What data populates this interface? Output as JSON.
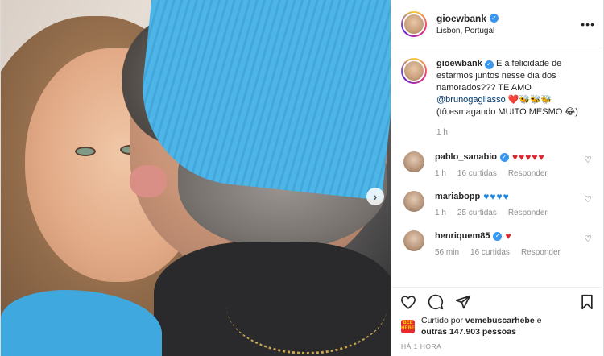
{
  "post": {
    "username": "gioewbank",
    "location": "Lisbon, Portugal",
    "caption_prefix": "E a felicidade de estarmos juntos nesse dia dos namorados??? TE AMO",
    "caption_mention": "@brunogagliasso",
    "caption_emojis": "❤️🐝🐝🐝",
    "caption_suffix": "(tô esmagando MUITO MESMO 😂)",
    "caption_time": "1 h",
    "time_ago": "HÁ 1 HORA"
  },
  "comments": [
    {
      "username": "pablo_sanabio",
      "text": "♥♥♥♥♥",
      "color": "red",
      "time": "1 h",
      "likes": "16 curtidas",
      "reply": "Responder"
    },
    {
      "username": "mariabopp",
      "text": "♥♥♥♥",
      "color": "blue",
      "time": "1 h",
      "likes": "25 curtidas",
      "reply": "Responder"
    },
    {
      "username": "henriquem85",
      "text": "♥",
      "color": "red",
      "time": "56 min",
      "likes": "16 curtidas",
      "reply": "Responder"
    }
  ],
  "liked_by": {
    "prefix": "Curtido por",
    "user": "vemebuscarhebe",
    "middle": "e",
    "others": "outras 147.903 pessoas"
  },
  "icons": {
    "more": "more-options-icon",
    "like": "heart-icon",
    "comment": "comment-icon",
    "share": "share-icon",
    "save": "bookmark-icon",
    "next": "chevron-right-icon"
  },
  "colors": {
    "verified": "#3897f0",
    "heart_red": "#e0242e",
    "heart_blue": "#1e88e5",
    "meta_gray": "#8e8e8e"
  }
}
